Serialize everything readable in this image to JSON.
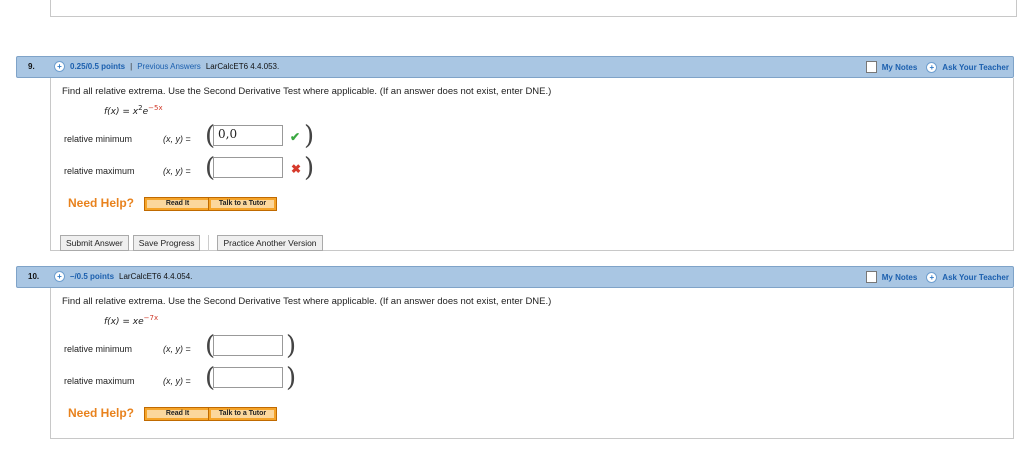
{
  "questions": [
    {
      "number": "9.",
      "points": "0.25/0.5 points",
      "separator": "|",
      "previous_answers": "Previous Answers",
      "assignment": "LarCalcET6 4.4.053.",
      "my_notes": "My Notes",
      "ask_teacher": "Ask Your Teacher",
      "prompt": "Find all relative extrema. Use the Second Derivative Test where applicable. (If an answer does not exist, enter DNE.)",
      "func_prefix": "f(x) = x",
      "func_exp1": "2",
      "func_base": "e",
      "func_exp2": "−5x",
      "rel_min_label": "relative minimum",
      "rel_max_label": "relative maximum",
      "xy_label": "(x, y)",
      "eq": "=",
      "min_value": "0,0",
      "max_value": "",
      "min_status": "correct",
      "max_status": "incorrect",
      "need_help": "Need Help?",
      "read_it": "Read It",
      "talk_tutor": "Talk to a Tutor",
      "submit": "Submit Answer",
      "save": "Save Progress",
      "practice": "Practice Another Version"
    },
    {
      "number": "10.",
      "points": "–/0.5 points",
      "assignment": "LarCalcET6 4.4.054.",
      "my_notes": "My Notes",
      "ask_teacher": "Ask Your Teacher",
      "prompt": "Find all relative extrema. Use the Second Derivative Test where applicable. (If an answer does not exist, enter DNE.)",
      "func_prefix": "f(x) = xe",
      "func_exp2": "−7x",
      "rel_min_label": "relative minimum",
      "rel_max_label": "relative maximum",
      "xy_label": "(x, y)",
      "eq": "=",
      "min_value": "",
      "max_value": "",
      "need_help": "Need Help?",
      "read_it": "Read It",
      "talk_tutor": "Talk to a Tutor"
    }
  ],
  "colors": {
    "header_bg": "#a9c6e3",
    "link_blue": "#1b5fae",
    "help_orange": "#e8821d",
    "correct_green": "#3aa841",
    "incorrect_red": "#d63a2c"
  },
  "icons": [
    "plus-circle-icon",
    "note-icon",
    "checkmark-icon",
    "cross-icon"
  ]
}
